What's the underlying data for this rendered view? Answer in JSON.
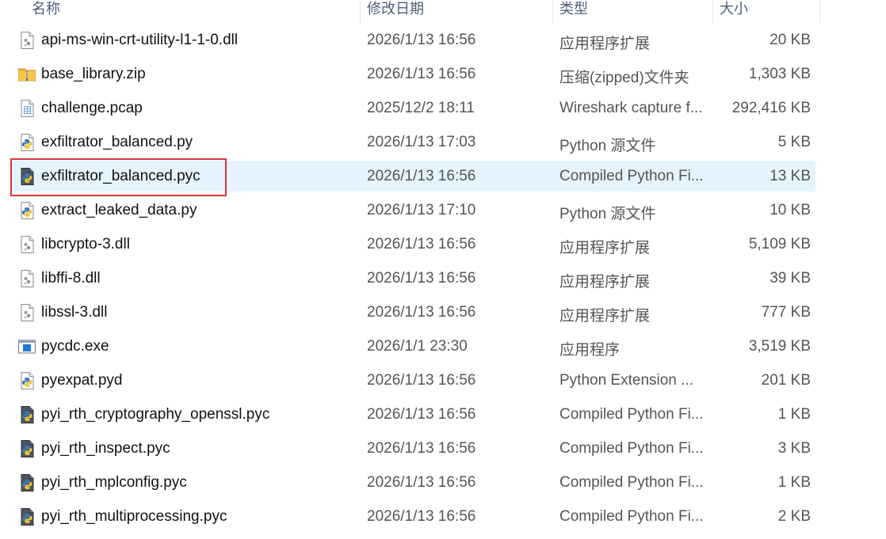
{
  "header": {
    "name": "名称",
    "date": "修改日期",
    "type": "类型",
    "size": "大小"
  },
  "files": [
    {
      "name": "api-ms-win-crt-utility-l1-1-0.dll",
      "date": "2026/1/13 16:56",
      "type": "应用程序扩展",
      "size": "20 KB",
      "icon": "dll-file-icon"
    },
    {
      "name": "base_library.zip",
      "date": "2026/1/13 16:56",
      "type": "压缩(zipped)文件夹",
      "size": "1,303 KB",
      "icon": "zip-folder-icon"
    },
    {
      "name": "challenge.pcap",
      "date": "2025/12/2 18:11",
      "type": "Wireshark capture f...",
      "size": "292,416 KB",
      "icon": "pcap-file-icon"
    },
    {
      "name": "exfiltrator_balanced.py",
      "date": "2026/1/13 17:03",
      "type": "Python 源文件",
      "size": "5 KB",
      "icon": "python-file-icon"
    },
    {
      "name": "exfiltrator_balanced.pyc",
      "date": "2026/1/13 16:56",
      "type": "Compiled Python Fi...",
      "size": "13 KB",
      "icon": "python-compiled-icon",
      "selected": true
    },
    {
      "name": "extract_leaked_data.py",
      "date": "2026/1/13 17:10",
      "type": "Python 源文件",
      "size": "10 KB",
      "icon": "python-file-icon"
    },
    {
      "name": "libcrypto-3.dll",
      "date": "2026/1/13 16:56",
      "type": "应用程序扩展",
      "size": "5,109 KB",
      "icon": "dll-file-icon"
    },
    {
      "name": "libffi-8.dll",
      "date": "2026/1/13 16:56",
      "type": "应用程序扩展",
      "size": "39 KB",
      "icon": "dll-file-icon"
    },
    {
      "name": "libssl-3.dll",
      "date": "2026/1/13 16:56",
      "type": "应用程序扩展",
      "size": "777 KB",
      "icon": "dll-file-icon"
    },
    {
      "name": "pycdc.exe",
      "date": "2026/1/1 23:30",
      "type": "应用程序",
      "size": "3,519 KB",
      "icon": "exe-file-icon"
    },
    {
      "name": "pyexpat.pyd",
      "date": "2026/1/13 16:56",
      "type": "Python Extension ...",
      "size": "201 KB",
      "icon": "python-file-icon"
    },
    {
      "name": "pyi_rth_cryptography_openssl.pyc",
      "date": "2026/1/13 16:56",
      "type": "Compiled Python Fi...",
      "size": "1 KB",
      "icon": "python-compiled-icon"
    },
    {
      "name": "pyi_rth_inspect.pyc",
      "date": "2026/1/13 16:56",
      "type": "Compiled Python Fi...",
      "size": "3 KB",
      "icon": "python-compiled-icon"
    },
    {
      "name": "pyi_rth_mplconfig.pyc",
      "date": "2026/1/13 16:56",
      "type": "Compiled Python Fi...",
      "size": "1 KB",
      "icon": "python-compiled-icon"
    },
    {
      "name": "pyi_rth_multiprocessing.pyc",
      "date": "2026/1/13 16:56",
      "type": "Compiled Python Fi...",
      "size": "2 KB",
      "icon": "python-compiled-icon"
    }
  ],
  "colors": {
    "selection": "#e5f3ff",
    "highlight_border": "#d9343a",
    "header_text": "#4c607a"
  }
}
